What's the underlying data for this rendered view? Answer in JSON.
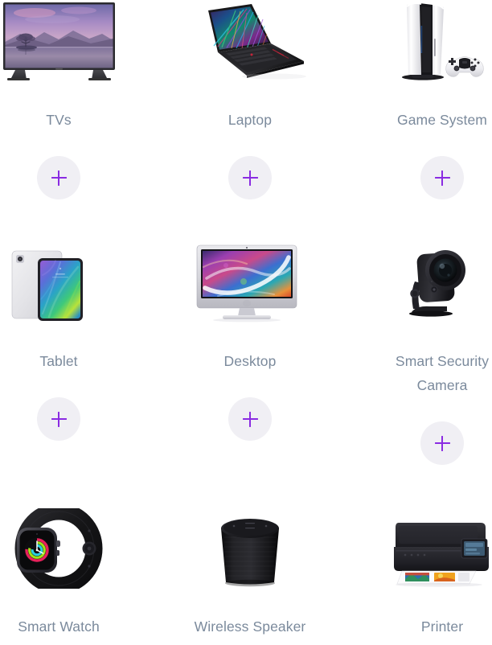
{
  "page": {
    "background_color": "#ffffff",
    "label_color": "#7b8a9c",
    "add_button_bg": "#f0eff4",
    "add_button_icon_color": "#8a2be2"
  },
  "grid": {
    "columns": 3,
    "rows": 3,
    "items": [
      {
        "label": "TVs",
        "image_name": "television-product-image",
        "add_label": "+",
        "add_name": "add-tvs-button"
      },
      {
        "label": "Laptop",
        "image_name": "laptop-product-image",
        "add_label": "+",
        "add_name": "add-laptop-button"
      },
      {
        "label": "Game System",
        "image_name": "game-console-product-image",
        "add_label": "+",
        "add_name": "add-game-system-button"
      },
      {
        "label": "Tablet",
        "image_name": "tablet-product-image",
        "add_label": "+",
        "add_name": "add-tablet-button"
      },
      {
        "label": "Desktop",
        "image_name": "desktop-computer-product-image",
        "add_label": "+",
        "add_name": "add-desktop-button"
      },
      {
        "label": "Smart Security Camera",
        "image_name": "security-camera-product-image",
        "add_label": "+",
        "add_name": "add-smart-security-camera-button"
      },
      {
        "label": "Smart Watch",
        "image_name": "smartwatch-product-image",
        "add_label": "+",
        "add_name": "add-smart-watch-button"
      },
      {
        "label": "Wireless Speaker",
        "image_name": "wireless-speaker-product-image",
        "add_label": "+",
        "add_name": "add-wireless-speaker-button"
      },
      {
        "label": "Printer",
        "image_name": "printer-product-image",
        "add_label": "+",
        "add_name": "add-printer-button"
      }
    ]
  }
}
